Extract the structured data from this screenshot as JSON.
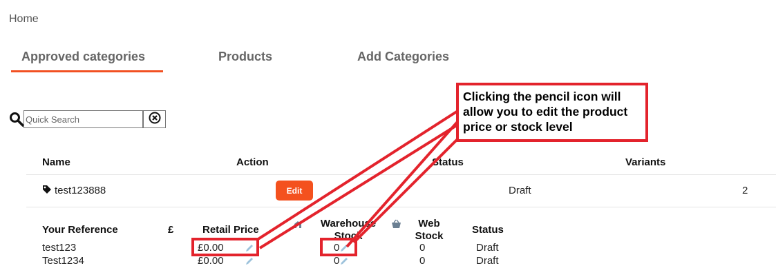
{
  "breadcrumb": {
    "home": "Home"
  },
  "tabs": [
    {
      "label": "Approved categories",
      "active": true
    },
    {
      "label": "Products",
      "active": false
    },
    {
      "label": "Add Categories",
      "active": false
    }
  ],
  "search": {
    "placeholder": "Quick Search"
  },
  "table": {
    "headers": {
      "name": "Name",
      "action": "Action",
      "status": "Status",
      "variants": "Variants"
    },
    "row": {
      "name": "test123888",
      "action_label": "Edit",
      "status": "Draft",
      "variants": "2"
    }
  },
  "variants": {
    "headers": {
      "reference": "Your Reference",
      "currency": "£",
      "retail_price": "Retail Price",
      "warehouse_stock": "Warehouse Stock",
      "web_stock": "Web Stock",
      "status": "Status"
    },
    "rows": [
      {
        "reference": "test123",
        "retail_price": "£0.00",
        "warehouse_stock": "0",
        "web_stock": "0",
        "status": "Draft"
      },
      {
        "reference": "Test1234",
        "retail_price": "£0.00",
        "warehouse_stock": "0",
        "web_stock": "0",
        "status": "Draft"
      }
    ]
  },
  "annotation": {
    "text": "Clicking the pencil icon will allow you to edit the product price or stock level",
    "color": "#e3232c"
  },
  "colors": {
    "accent": "#f25022",
    "edit_button": "#f4511e",
    "pencil": "#9ec3dc"
  }
}
